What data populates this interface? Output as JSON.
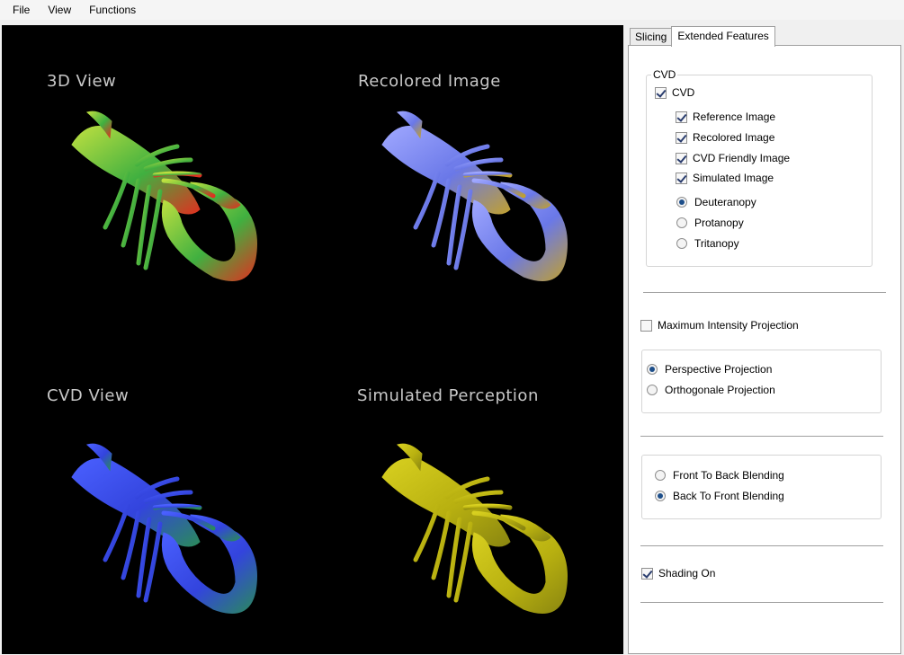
{
  "menu": {
    "file": "File",
    "view": "View",
    "functions": "Functions"
  },
  "viewport": {
    "views": [
      {
        "label": "3D View",
        "colors": [
          "#c0e040",
          "#40b040",
          "#e03020"
        ]
      },
      {
        "label": "Recolored Image",
        "colors": [
          "#a0a8ff",
          "#6a78e8",
          "#c0a030"
        ]
      },
      {
        "label": "CVD View",
        "colors": [
          "#4a60ff",
          "#3344dd",
          "#2a8a5a"
        ]
      },
      {
        "label": "Simulated Perception",
        "colors": [
          "#d8d020",
          "#b8b010",
          "#8a8610"
        ]
      }
    ]
  },
  "tabs": {
    "slicing": "Slicing",
    "extended": "Extended Features"
  },
  "cvd_group": {
    "title": "CVD",
    "cvd": {
      "label": "CVD",
      "checked": true
    },
    "reference": {
      "label": "Reference Image",
      "checked": true
    },
    "recolored": {
      "label": "Recolored Image",
      "checked": true
    },
    "friendly": {
      "label": "CVD Friendly Image",
      "checked": true
    },
    "simulated": {
      "label": "Simulated Image",
      "checked": true
    },
    "deuteranopy": {
      "label": "Deuteranopy",
      "selected": true
    },
    "protanopy": {
      "label": "Protanopy",
      "selected": false
    },
    "tritanopy": {
      "label": "Tritanopy",
      "selected": false
    }
  },
  "mip": {
    "label": "Maximum Intensity Projection",
    "checked": false
  },
  "projection": {
    "perspective": {
      "label": "Perspective Projection",
      "selected": true
    },
    "orthogonal": {
      "label": "Orthogonale Projection",
      "selected": false
    }
  },
  "blending": {
    "front_to_back": {
      "label": "Front To Back Blending",
      "selected": false
    },
    "back_to_front": {
      "label": "Back To Front Blending",
      "selected": true
    }
  },
  "shading": {
    "label": "Shading On",
    "checked": true
  },
  "colors": {
    "viewport_bg": "#000000",
    "panel_bg": "#ffffff",
    "window_bg": "#f0f0f0",
    "check_mark": "#2a3d6e",
    "radio_dot": "#1e4f8a"
  }
}
